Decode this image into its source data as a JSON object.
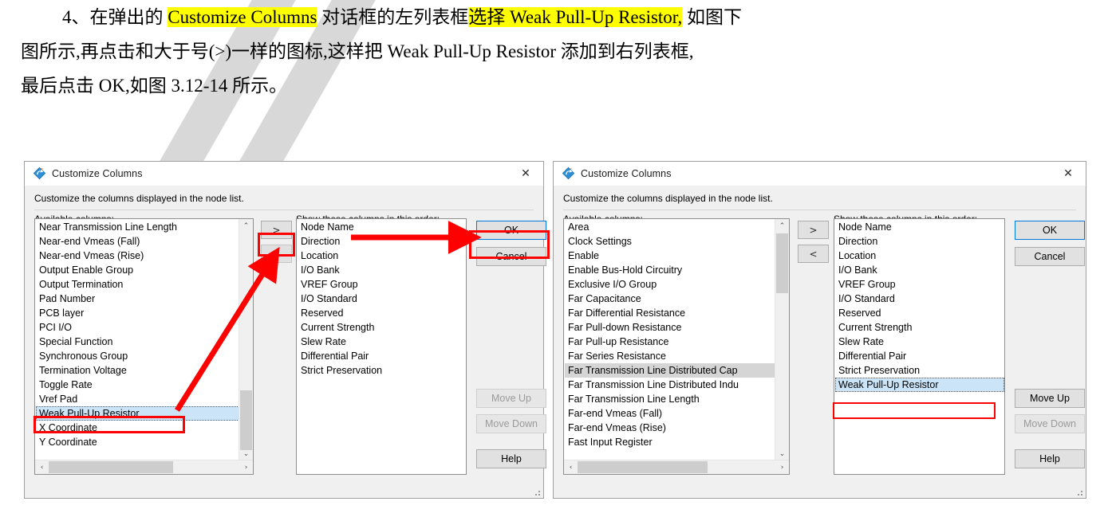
{
  "document": {
    "lines": [
      {
        "id": "line1",
        "segments": [
          {
            "text": "4、在弹出的 ",
            "hl": false
          },
          {
            "text": "Customize Columns",
            "hl": true
          },
          {
            "text": " 对话框的左列表框",
            "hl": false
          },
          {
            "text": "选择 Weak Pull-Up Resistor,",
            "hl": true
          },
          {
            "text": " 如图下",
            "hl": false
          }
        ]
      },
      {
        "id": "line2",
        "segments": [
          {
            "text": "图所示,再点击和大于号(>)一样的图标,这样把 Weak Pull-Up Resistor 添加到右列表框,",
            "hl": false
          }
        ]
      },
      {
        "id": "line3",
        "segments": [
          {
            "text": "最后点击 OK,如图 3.12-14 所示。",
            "hl": false
          }
        ]
      }
    ]
  },
  "dialog_left": {
    "title": "Customize Columns",
    "close_icon": "✕",
    "description": "Customize the columns displayed in the node list.",
    "available_label": "Available columns:",
    "show_label": "Show these columns in this order:",
    "available_items": [
      "Near Transmission Line Length",
      "Near-end Vmeas (Fall)",
      "Near-end Vmeas (Rise)",
      "Output Enable Group",
      "Output Termination",
      "Pad Number",
      "PCB layer",
      "PCI I/O",
      "Special Function",
      "Synchronous Group",
      "Termination Voltage",
      "Toggle Rate",
      "Vref Pad",
      "Weak Pull-Up Resistor",
      "X Coordinate",
      "Y Coordinate"
    ],
    "available_selected_index": 13,
    "shown_items": [
      "Node Name",
      "Direction",
      "Location",
      "I/O Bank",
      "VREF Group",
      "I/O Standard",
      "Reserved",
      "Current Strength",
      "Slew Rate",
      "Differential Pair",
      "Strict Preservation"
    ],
    "shown_selected_index": -1,
    "add_button": ">",
    "remove_button": "<",
    "ok_button": "OK",
    "cancel_button": "Cancel",
    "move_up_button": "Move Up",
    "move_down_button": "Move Down",
    "help_button": "Help",
    "scroll_up_arrow": "⌃",
    "scroll_down_arrow": "⌄",
    "scroll_left_arrow": "‹",
    "scroll_right_arrow": "›"
  },
  "dialog_right": {
    "title": "Customize Columns",
    "close_icon": "✕",
    "description": "Customize the columns displayed in the node list.",
    "available_label": "Available columns:",
    "show_label": "Show these columns in this order:",
    "available_items": [
      "Area",
      "Clock Settings",
      "Enable",
      "Enable Bus-Hold Circuitry",
      "Exclusive I/O Group",
      "Far Capacitance",
      "Far Differential Resistance",
      "Far Pull-down Resistance",
      "Far Pull-up Resistance",
      "Far Series Resistance",
      "Far Transmission Line Distributed Cap",
      "Far Transmission Line Distributed Indu",
      "Far Transmission Line Length",
      "Far-end Vmeas (Fall)",
      "Far-end Vmeas (Rise)",
      "Fast Input Register"
    ],
    "available_selected_index": 10,
    "shown_items": [
      "Node Name",
      "Direction",
      "Location",
      "I/O Bank",
      "VREF Group",
      "I/O Standard",
      "Reserved",
      "Current Strength",
      "Slew Rate",
      "Differential Pair",
      "Strict Preservation",
      "Weak Pull-Up Resistor"
    ],
    "shown_selected_index": 11,
    "add_button": ">",
    "remove_button": "<",
    "ok_button": "OK",
    "cancel_button": "Cancel",
    "move_up_button": "Move Up",
    "move_down_button": "Move Down",
    "help_button": "Help",
    "scroll_up_arrow": "⌃",
    "scroll_down_arrow": "⌄",
    "scroll_left_arrow": "‹",
    "scroll_right_arrow": "›"
  },
  "annotations": {
    "highlight_color": "#ffff00",
    "box_color": "#ff0000",
    "arrow_color": "#ff0000"
  }
}
